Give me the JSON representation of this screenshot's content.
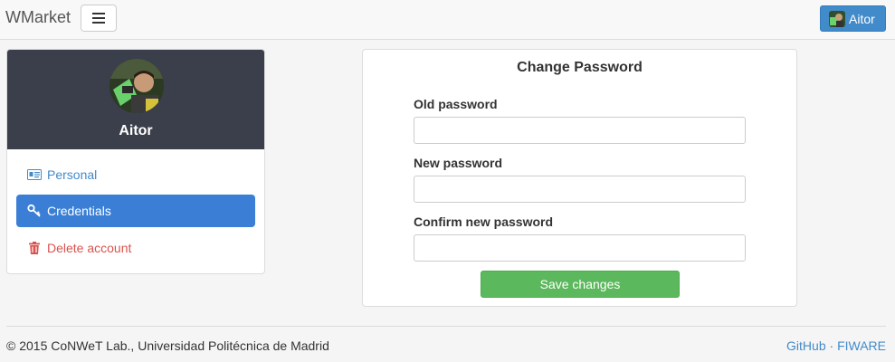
{
  "navbar": {
    "brand": "WMarket",
    "menu_icon": "hamburger-icon",
    "user_label": "Aitor"
  },
  "profile": {
    "name": "Aitor",
    "nav": [
      {
        "label": "Personal",
        "icon": "id-card-icon",
        "active": false
      },
      {
        "label": "Credentials",
        "icon": "key-icon",
        "active": true
      },
      {
        "label": "Delete account",
        "icon": "trash-icon",
        "active": false
      }
    ]
  },
  "password_form": {
    "title": "Change Password",
    "old_label": "Old password",
    "old_value": "",
    "new_label": "New password",
    "new_value": "",
    "confirm_label": "Confirm new password",
    "confirm_value": "",
    "save_label": "Save changes"
  },
  "footer": {
    "copyright": "© 2015 CoNWeT Lab., Universidad Politécnica de Madrid",
    "github": "GitHub",
    "separator": "·",
    "fiware": "FIWARE"
  },
  "colors": {
    "primary": "#428bca",
    "active_nav": "#3a7fd5",
    "danger": "#d9534f",
    "success": "#5cb85c",
    "profile_header": "#3a3f4b"
  }
}
